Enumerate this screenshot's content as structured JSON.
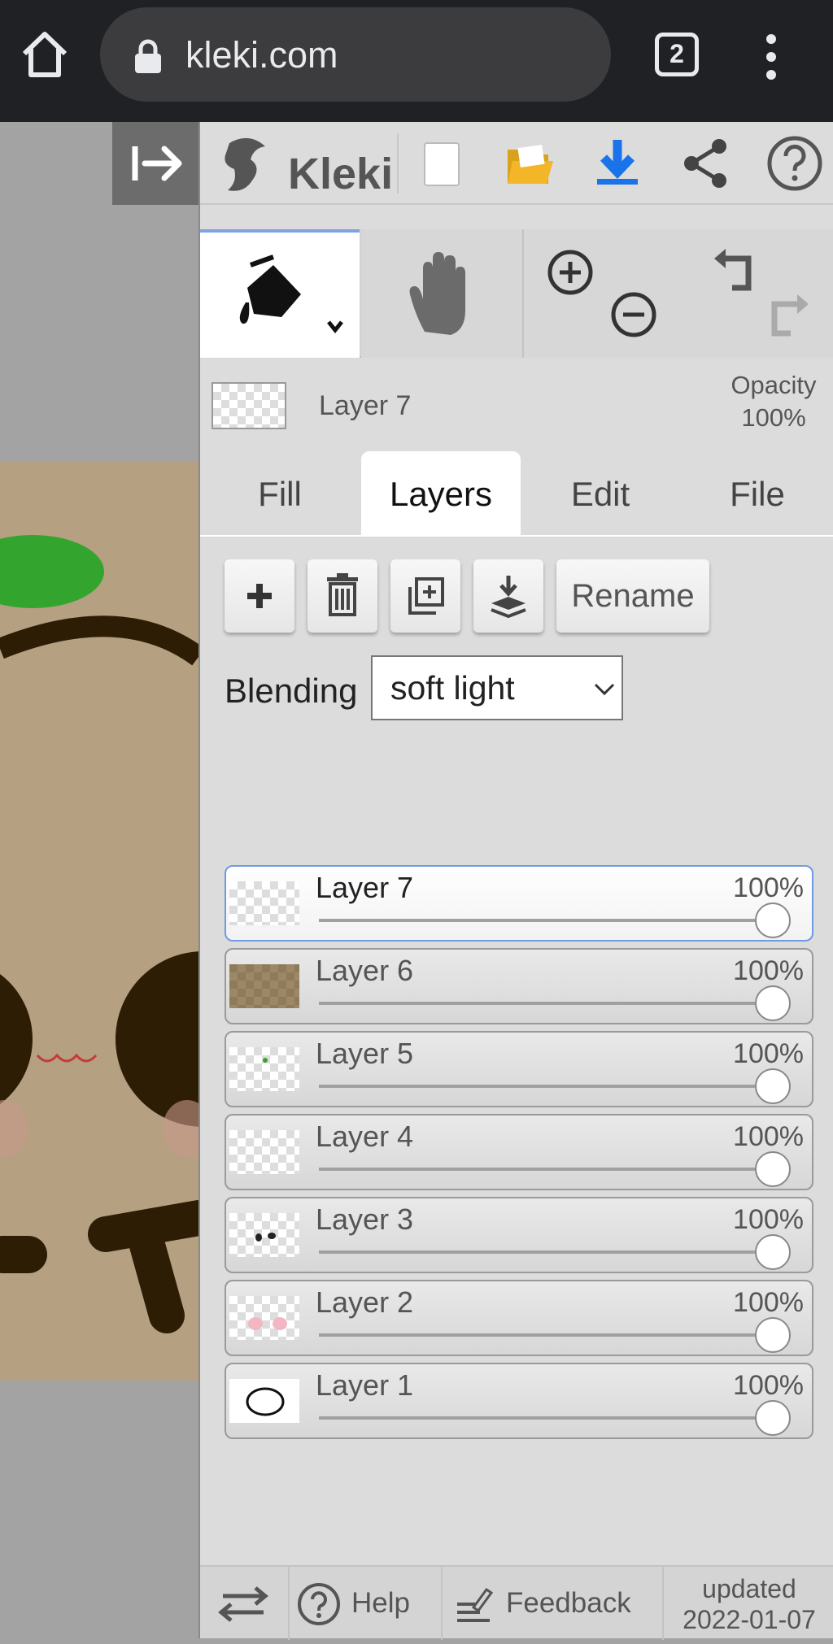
{
  "browser": {
    "url": "kleki.com",
    "tab_count": "2"
  },
  "app": {
    "logo_text": "Kleki",
    "active_layer": {
      "name": "Layer 7",
      "opacity_label": "Opacity",
      "opacity_value": "100%"
    },
    "tabs": [
      {
        "label": "Fill"
      },
      {
        "label": "Layers"
      },
      {
        "label": "Edit"
      },
      {
        "label": "File"
      }
    ],
    "layers_panel": {
      "rename_label": "Rename",
      "blending_label": "Blending",
      "blending_value": "soft light",
      "layers": [
        {
          "name": "Layer 7",
          "opacity": "100%"
        },
        {
          "name": "Layer 6",
          "opacity": "100%"
        },
        {
          "name": "Layer 5",
          "opacity": "100%"
        },
        {
          "name": "Layer 4",
          "opacity": "100%"
        },
        {
          "name": "Layer 3",
          "opacity": "100%"
        },
        {
          "name": "Layer 2",
          "opacity": "100%"
        },
        {
          "name": "Layer 1",
          "opacity": "100%"
        }
      ]
    },
    "footer": {
      "help_label": "Help",
      "feedback_label": "Feedback",
      "updated_label": "updated",
      "updated_date": "2022-01-07"
    }
  },
  "colors": {
    "accent": "#7fa3e0",
    "download_blue": "#1a73e8",
    "folder_yellow": "#f2b628",
    "canvas_bg": "#b5a081"
  }
}
